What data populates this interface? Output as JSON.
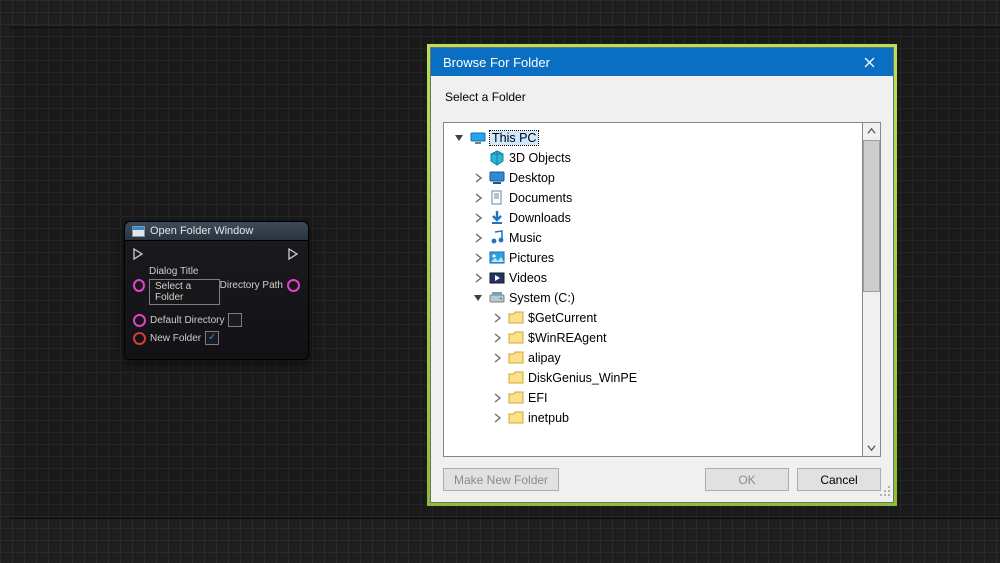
{
  "node": {
    "title": "Open Folder Window",
    "pins": {
      "dialog_title_label": "Dialog Title",
      "dialog_title_value": "Select a Folder",
      "directory_path_label": "Directory Path",
      "default_directory_label": "Default Directory",
      "default_directory_checked": false,
      "new_folder_label": "New Folder",
      "new_folder_checked": true
    }
  },
  "dialog": {
    "title": "Browse For Folder",
    "instruction": "Select a Folder",
    "buttons": {
      "make_new_folder": "Make New Folder",
      "ok": "OK",
      "cancel": "Cancel"
    },
    "tree": [
      {
        "label": "This PC",
        "indent": 0,
        "expand": "open",
        "icon": "pc",
        "selected": true
      },
      {
        "label": "3D Objects",
        "indent": 1,
        "expand": "none",
        "icon": "3d"
      },
      {
        "label": "Desktop",
        "indent": 1,
        "expand": "closed",
        "icon": "desktop"
      },
      {
        "label": "Documents",
        "indent": 1,
        "expand": "closed",
        "icon": "docs"
      },
      {
        "label": "Downloads",
        "indent": 1,
        "expand": "closed",
        "icon": "downloads"
      },
      {
        "label": "Music",
        "indent": 1,
        "expand": "closed",
        "icon": "music"
      },
      {
        "label": "Pictures",
        "indent": 1,
        "expand": "closed",
        "icon": "pictures"
      },
      {
        "label": "Videos",
        "indent": 1,
        "expand": "closed",
        "icon": "videos"
      },
      {
        "label": "System (C:)",
        "indent": 1,
        "expand": "open",
        "icon": "drive"
      },
      {
        "label": "$GetCurrent",
        "indent": 2,
        "expand": "closed",
        "icon": "folder"
      },
      {
        "label": "$WinREAgent",
        "indent": 2,
        "expand": "closed",
        "icon": "folder"
      },
      {
        "label": "alipay",
        "indent": 2,
        "expand": "closed",
        "icon": "folder"
      },
      {
        "label": "DiskGenius_WinPE",
        "indent": 2,
        "expand": "none",
        "icon": "folder"
      },
      {
        "label": "EFI",
        "indent": 2,
        "expand": "closed",
        "icon": "folder"
      },
      {
        "label": "inetpub",
        "indent": 2,
        "expand": "closed",
        "icon": "folder"
      }
    ]
  }
}
